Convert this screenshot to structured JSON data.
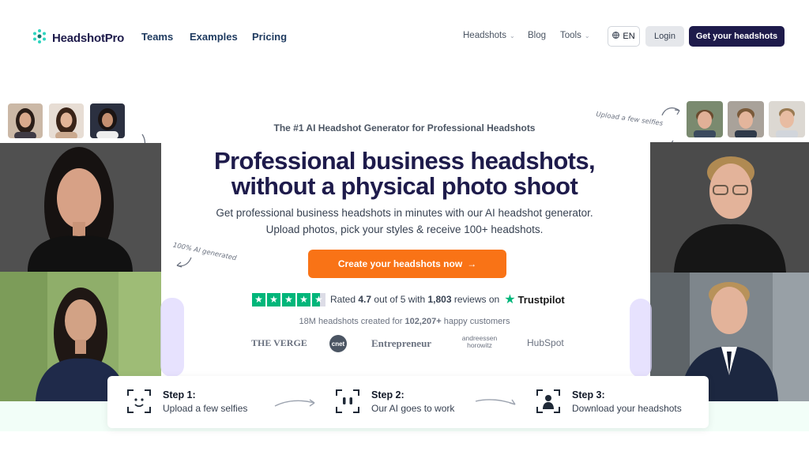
{
  "nav": {
    "brand": "HeadshotPro",
    "links": [
      "Teams",
      "Examples",
      "Pricing"
    ],
    "right_links": [
      "Headshots",
      "Blog",
      "Tools"
    ],
    "lang": "EN",
    "login": "Login",
    "cta": "Get your headshots"
  },
  "hero": {
    "tagline": "The #1 AI Headshot Generator for Professional Headshots",
    "headline_line1": "Professional business headshots,",
    "headline_line2": "without a physical photo shoot",
    "subtext": "Get professional business headshots in minutes with our AI headshot generator. Upload photos, pick your styles & receive 100+ headshots.",
    "cta": "Create your headshots now",
    "rating_prefix": "Rated",
    "rating_value": "4.7",
    "rating_mid": "out of 5 with",
    "review_count": "1,803",
    "rating_suffix": "reviews on",
    "trustpilot": "Trustpilot",
    "rating_stars": 4.5,
    "customers_prefix": "18M headshots created for",
    "customers_count": "102,207+",
    "customers_suffix": "happy customers"
  },
  "press": [
    "THE VERGE",
    "cnet",
    "Entrepreneur",
    "andreessen horowitz",
    "HubSpot"
  ],
  "annotations": {
    "upload": "Upload a few selfies",
    "ai": "100% AI generated"
  },
  "steps": [
    {
      "title": "Step 1:",
      "desc": "Upload a few selfies",
      "icon": "face-scan-icon"
    },
    {
      "title": "Step 2:",
      "desc": "Our AI goes to work",
      "icon": "ai-scan-icon"
    },
    {
      "title": "Step 3:",
      "desc": "Download your headshots",
      "icon": "person-frame-icon"
    }
  ],
  "colors": {
    "brand": "#1e1b4b",
    "accent": "#f97316",
    "trustpilot": "#00b67a",
    "logo": "#2dd4bf"
  }
}
